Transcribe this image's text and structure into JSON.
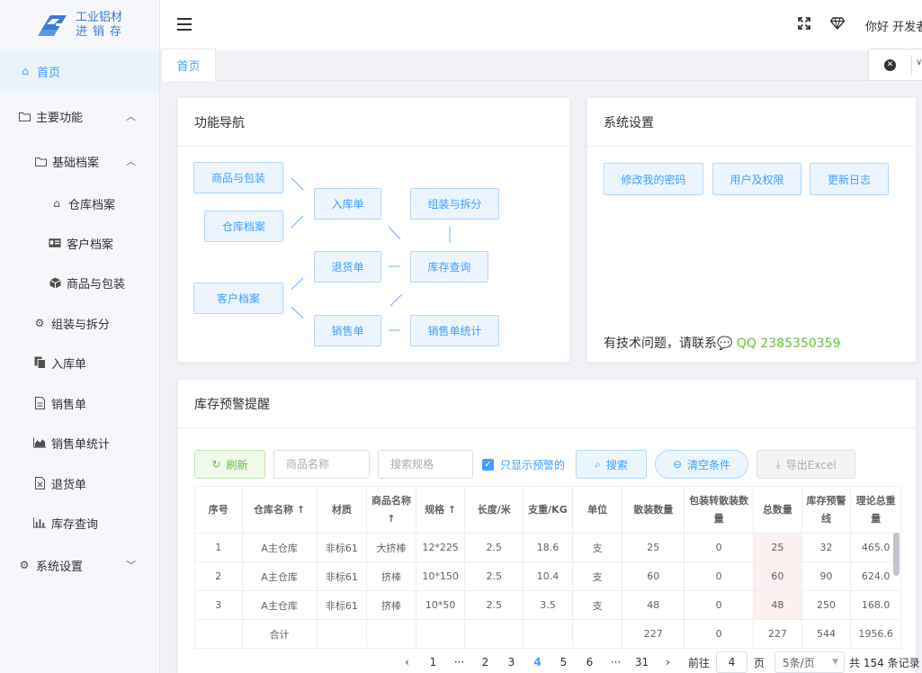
{
  "app": {
    "logo_line1": "工业铝材",
    "logo_line2": "进销存",
    "greeting": "你好 开发者"
  },
  "sidebar": {
    "items": [
      {
        "label": "首页",
        "icon": "home-icon"
      },
      {
        "label": "主要功能",
        "icon": "folder-icon"
      },
      {
        "label": "基础档案",
        "icon": "folder-icon"
      },
      {
        "label": "仓库档案",
        "icon": "home-icon"
      },
      {
        "label": "客户档案",
        "icon": "id-card-icon"
      },
      {
        "label": "商品与包装",
        "icon": "cube-icon"
      },
      {
        "label": "组装与拆分",
        "icon": "cogs-icon"
      },
      {
        "label": "入库单",
        "icon": "copy-icon"
      },
      {
        "label": "销售单",
        "icon": "file-icon"
      },
      {
        "label": "销售单统计",
        "icon": "area-chart-icon"
      },
      {
        "label": "退货单",
        "icon": "file-excel-icon"
      },
      {
        "label": "库存查询",
        "icon": "bar-chart-icon"
      },
      {
        "label": "系统设置",
        "icon": "gear-icon"
      }
    ]
  },
  "tabs": {
    "home": "首页"
  },
  "nav_card": {
    "title": "功能导航",
    "nodes": {
      "goods": "商品与包装",
      "warehouse": "仓库档案",
      "customer": "客户档案",
      "inbound": "入库单",
      "returns": "退货单",
      "sales": "销售单",
      "assemble": "组装与拆分",
      "stock": "库存查询",
      "sales_stat": "销售单统计"
    }
  },
  "settings_card": {
    "title": "系统设置",
    "buttons": [
      "修改我的密码",
      "用户及权限",
      "更新日志"
    ],
    "contact_prefix": "有技术问题，请联系",
    "contact_qq": "QQ 2385350359"
  },
  "stock_card": {
    "title": "库存预警提醒",
    "refresh": "刷新",
    "goods_placeholder": "商品名称",
    "spec_placeholder": "搜索规格",
    "only_warning": "只显示预警的",
    "search": "搜索",
    "clear": "清空条件",
    "export": "导出Excel",
    "columns": [
      "序号",
      "仓库名称 ↑",
      "材质",
      "商品名称 ↑",
      "规格 ↑",
      "长度/米",
      "支重/KG",
      "单位",
      "散装数量",
      "包装转散装数量",
      "总数量",
      "库存预警线",
      "理论总重量"
    ],
    "rows": [
      [
        "1",
        "A主仓库",
        "非标61",
        "大挤棒",
        "12*225",
        "2.5",
        "18.6",
        "支",
        "25",
        "0",
        "25",
        "32",
        "465.0"
      ],
      [
        "2",
        "A主仓库",
        "非标61",
        "挤棒",
        "10*150",
        "2.5",
        "10.4",
        "支",
        "60",
        "0",
        "60",
        "90",
        "624.0"
      ],
      [
        "3",
        "A主仓库",
        "非标61",
        "挤棒",
        "10*50",
        "2.5",
        "3.5",
        "支",
        "48",
        "0",
        "48",
        "250",
        "168.0"
      ]
    ],
    "sum_row": [
      "",
      "合计",
      "",
      "",
      "",
      "",
      "",
      "",
      "227",
      "0",
      "227",
      "544",
      "1956.6"
    ]
  },
  "pagination": {
    "pages": [
      "1",
      "···",
      "2",
      "3",
      "4",
      "5",
      "6",
      "···",
      "31"
    ],
    "current": "4",
    "goto_label": "前往",
    "goto_value": "4",
    "page_unit": "页",
    "page_size": "5条/页",
    "total": "共 154 条记录"
  },
  "colors": {
    "primary": "#409eff",
    "success": "#67c23a",
    "highlight_cell": "#fdf0f0"
  }
}
